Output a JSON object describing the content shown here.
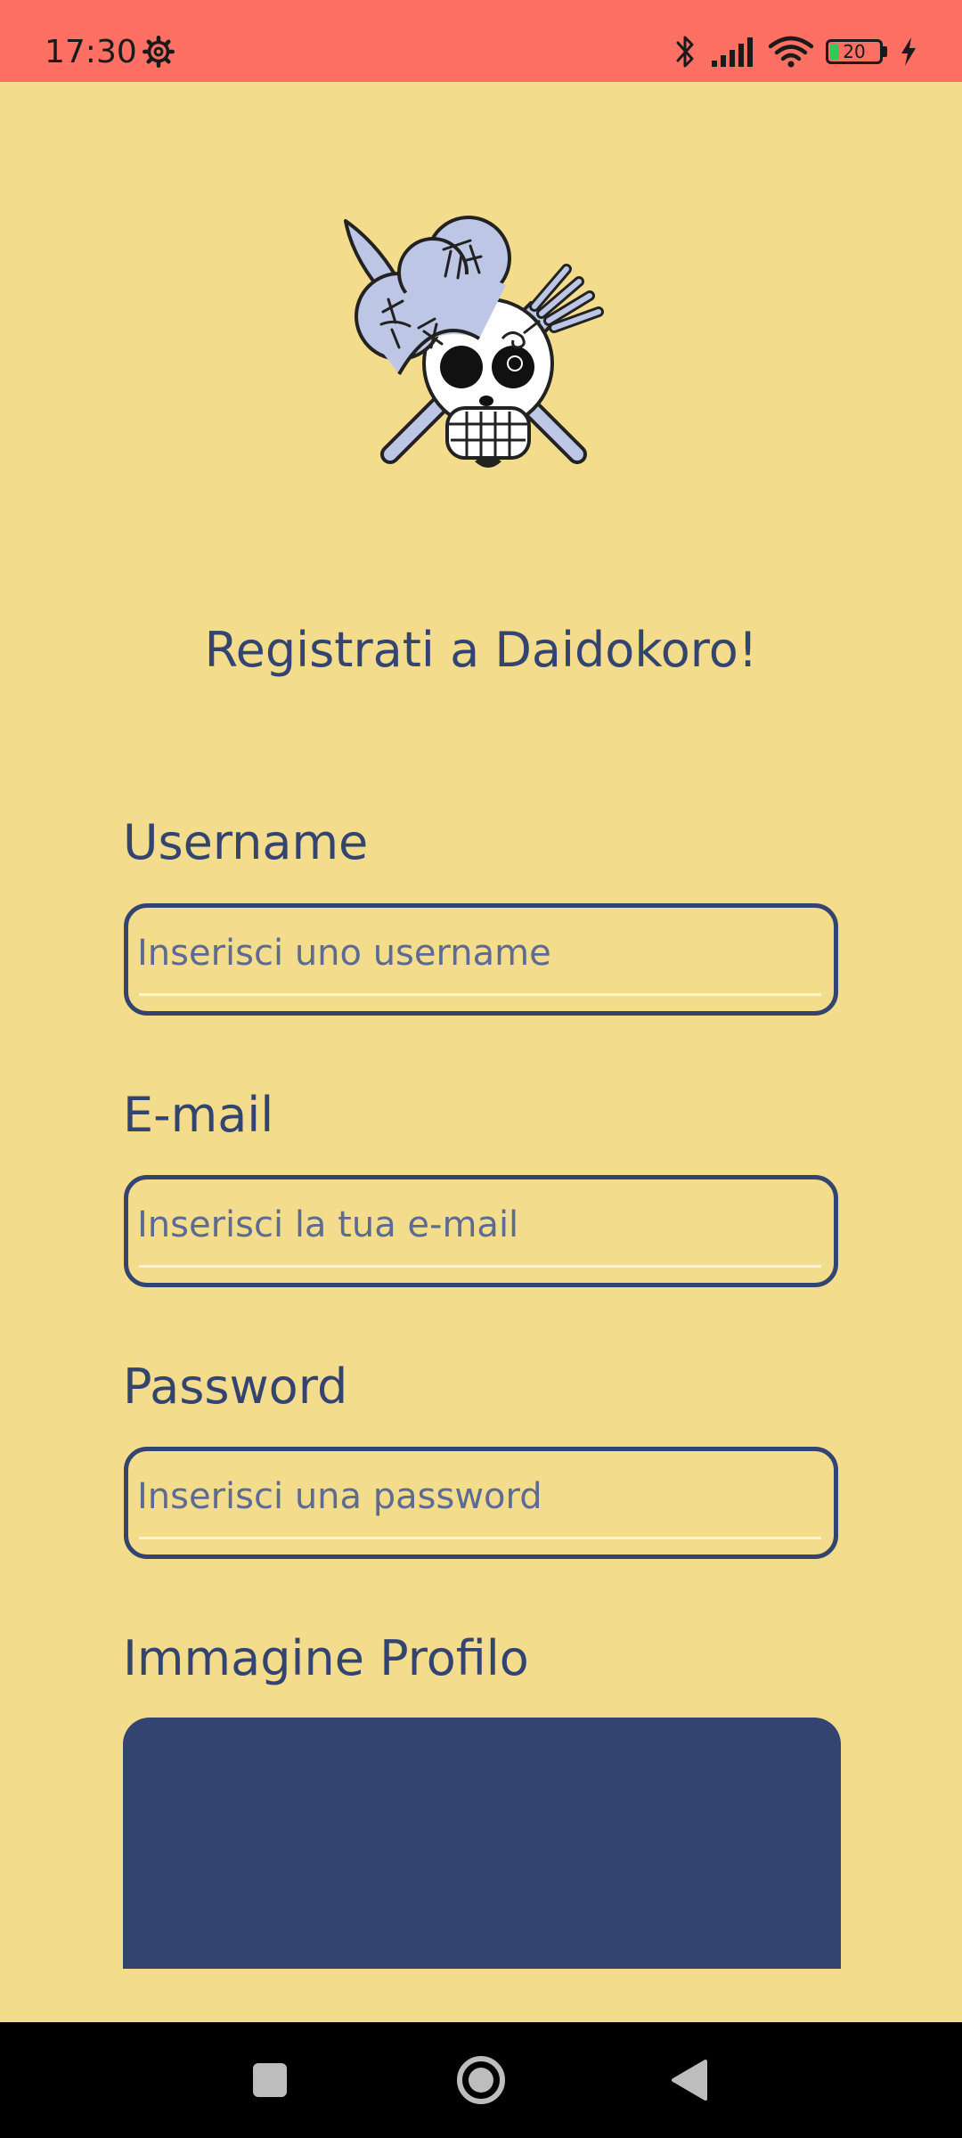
{
  "status_bar": {
    "time": "17:30",
    "battery_level": "20",
    "icons": [
      "gear-icon",
      "bluetooth-icon",
      "signal-icon",
      "wifi-icon",
      "battery-icon",
      "charging-icon"
    ]
  },
  "logo": {
    "icon": "skull-chef-logo"
  },
  "form": {
    "title": "Registrati a Daidokoro!",
    "username_label": "Username",
    "username_placeholder": "Inserisci uno username",
    "email_label": "E-mail",
    "email_placeholder": "Inserisci la tua e-mail",
    "password_label": "Password",
    "password_placeholder": "Inserisci una password",
    "image_label": "Immagine Profilo"
  },
  "nav": {
    "icons": [
      "recents-icon",
      "home-icon",
      "back-icon"
    ]
  },
  "colors": {
    "background": "#f3dc8c",
    "status_bar": "#fe7063",
    "primary": "#334471"
  }
}
